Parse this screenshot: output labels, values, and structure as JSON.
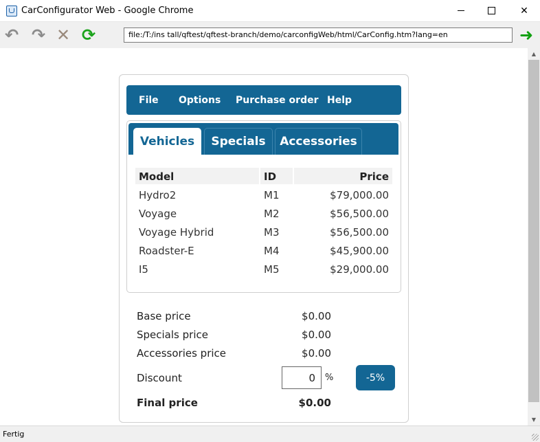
{
  "window": {
    "title": "CarConfigurator Web - Google Chrome",
    "min_icon": "minimize-icon",
    "max_icon": "maximize-icon",
    "close_glyph": "✕"
  },
  "toolbar": {
    "undo_glyph": "↶",
    "redo_glyph": "↷",
    "stop_glyph": "✕",
    "reload_glyph": "⟳",
    "url": "file:/T:/ins tall/qftest/qftest-branch/demo/carconfigWeb/html/CarConfig.htm?lang=en",
    "go_glyph": "➜"
  },
  "menu": {
    "items": [
      "File",
      "Options",
      "Purchase order",
      "Help"
    ]
  },
  "tabs": {
    "items": [
      "Vehicles",
      "Specials",
      "Accessories"
    ],
    "active": "Vehicles"
  },
  "table": {
    "headers": {
      "model": "Model",
      "id": "ID",
      "price": "Price"
    },
    "rows": [
      {
        "model": "Hydro2",
        "id": "M1",
        "price": "$79,000.00"
      },
      {
        "model": "Voyage",
        "id": "M2",
        "price": "$56,500.00"
      },
      {
        "model": "Voyage Hybrid",
        "id": "M3",
        "price": "$56,500.00"
      },
      {
        "model": "Roadster-E",
        "id": "M4",
        "price": "$45,900.00"
      },
      {
        "model": "I5",
        "id": "M5",
        "price": "$29,000.00"
      }
    ]
  },
  "summary": {
    "base_label": "Base price",
    "base_value": "$0.00",
    "specials_label": "Specials price",
    "specials_value": "$0.00",
    "accessories_label": "Accessories price",
    "accessories_value": "$0.00",
    "discount_label": "Discount",
    "discount_value": "0",
    "percent_sign": "%",
    "discount_button": "-5%",
    "final_label": "Final price",
    "final_value": "$0.00"
  },
  "status": {
    "text": "Fertig"
  },
  "scrollbar": {
    "up_glyph": "▲",
    "down_glyph": "▼"
  },
  "colors": {
    "accent": "#136694",
    "reload_green": "#1ca31c"
  }
}
